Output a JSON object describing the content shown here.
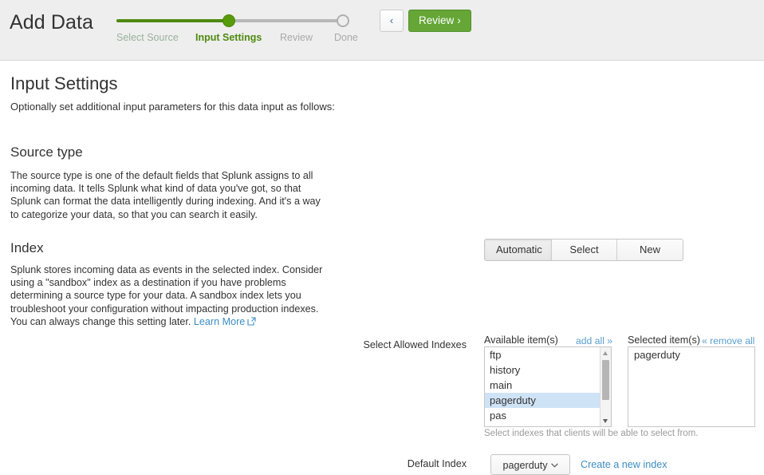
{
  "header": {
    "app_title": "Add Data",
    "wizard": {
      "steps": [
        {
          "label": "Select Source",
          "state": "done"
        },
        {
          "label": "Input Settings",
          "state": "active"
        },
        {
          "label": "Review",
          "state": "todo"
        },
        {
          "label": "Done",
          "state": "todo"
        }
      ],
      "progress_percent": 50,
      "fill_color": "#4f8a10",
      "track_color": "#b8b8b8"
    },
    "back_button": {
      "icon": "chevron-left-icon",
      "glyph": "‹"
    },
    "review_button": {
      "label": "Review",
      "glyph": "›",
      "color": "#65a637"
    }
  },
  "main": {
    "page_title": "Input Settings",
    "page_subtitle": "Optionally set additional input parameters for this data input as follows:",
    "source_type": {
      "heading": "Source type",
      "description": "The source type is one of the default fields that Splunk assigns to all incoming data. It tells Splunk what kind of data you've got, so that Splunk can format the data intelligently during indexing. And it's a way to categorize your data, so that you can search it easily.",
      "options": [
        "Automatic",
        "Select",
        "New"
      ],
      "selected": "Automatic"
    },
    "index": {
      "heading": "Index",
      "description_before_link": "Splunk stores incoming data as events in the selected index. Consider using a \"sandbox\" index as a destination if you have problems determining a source type for your data. A sandbox index lets you troubleshoot your configuration without impacting production indexes. You can always change this setting later. ",
      "learn_more_label": "Learn More",
      "learn_more_icon": "external-link-icon",
      "allowed_indexes": {
        "field_label": "Select Allowed Indexes",
        "available_header": "Available item(s)",
        "add_all_label": "add all »",
        "selected_header": "Selected item(s)",
        "remove_all_label": "« remove all",
        "available_items": [
          "ftp",
          "history",
          "main",
          "pagerduty",
          "pas"
        ],
        "available_highlighted": "pagerduty",
        "selected_items": [
          "pagerduty"
        ],
        "help_text": "Select indexes that clients will be able to select from.",
        "highlight_color": "#cfe3f6"
      },
      "default_index": {
        "field_label": "Default Index",
        "value": "pagerduty",
        "caret_icon": "chevron-down-icon",
        "caret_glyph": "⌄",
        "create_link_label": "Create a new index"
      }
    }
  }
}
